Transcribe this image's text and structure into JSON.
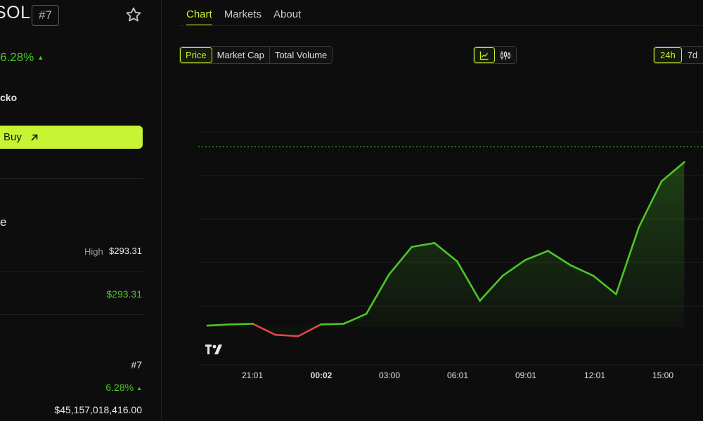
{
  "coin": {
    "symbol": "SOL",
    "rank_badge": "#7",
    "change_24h": "6.28%",
    "source_fragment": "cko",
    "buy_label": "Buy",
    "section_fragment": "e"
  },
  "stats": {
    "high_label": "High",
    "high_value": "$293.31",
    "value_green": "$293.31",
    "rank_value": "#7",
    "change_value": "6.28%",
    "market_cap_value": "$45,157,018,416.00"
  },
  "tabs": [
    {
      "label": "Chart",
      "active": true
    },
    {
      "label": "Markets",
      "active": false
    },
    {
      "label": "About",
      "active": false
    }
  ],
  "metric_options": [
    "Price",
    "Market Cap",
    "Total Volume"
  ],
  "chart_type_icons": [
    "line-chart-icon",
    "candlestick-icon"
  ],
  "range_options": [
    "24h",
    "7d"
  ],
  "colors": {
    "accent": "#c6f432",
    "up": "#4cc62a",
    "down": "#e0474c",
    "background": "#0d0d0d"
  },
  "chart_data": {
    "type": "line",
    "x_ticks": [
      "21:01",
      "00:02",
      "03:00",
      "06:01",
      "09:01",
      "12:01",
      "15:00"
    ],
    "bold_tick": "00:02",
    "x_hours": [
      -1,
      0,
      1,
      2,
      3,
      4,
      5,
      6,
      7,
      8,
      9,
      10,
      11,
      12,
      13,
      14,
      15,
      16,
      17,
      18,
      19,
      20
    ],
    "values": [
      0.05,
      0.1,
      0.12,
      -0.3,
      -0.35,
      0.1,
      0.12,
      0.5,
      2.0,
      3.05,
      3.2,
      2.5,
      1.0,
      1.95,
      2.55,
      2.9,
      2.35,
      1.95,
      1.25,
      3.8,
      5.55,
      6.28
    ],
    "reference_value": 6.28,
    "y_unit": "% change",
    "grid": true,
    "watermark": "TV"
  }
}
